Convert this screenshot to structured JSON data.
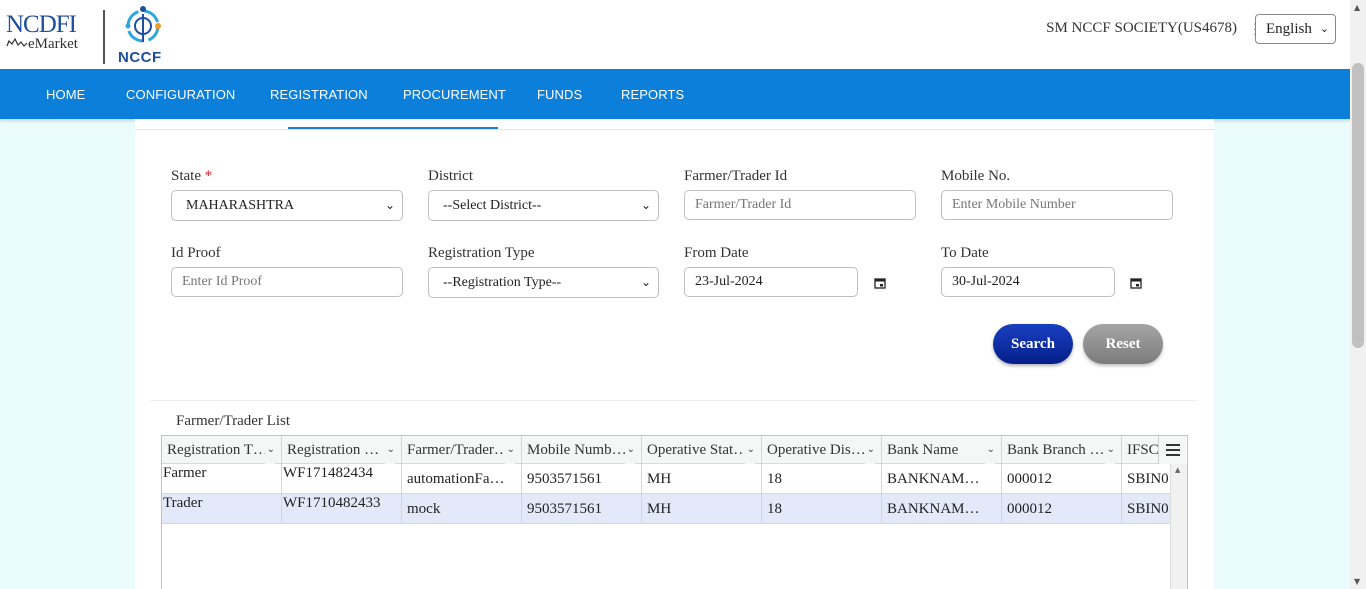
{
  "header": {
    "logo1_main": "NCDFI",
    "logo1_sub": "eMarket",
    "logo2_text": "NCCF",
    "society": "SM NCCF SOCIETY(US4678)",
    "language": "English"
  },
  "nav": [
    "HOME",
    "CONFIGURATION",
    "REGISTRATION",
    "PROCUREMENT",
    "FUNDS",
    "REPORTS"
  ],
  "form": {
    "state_label": "State",
    "required_mark": "*",
    "state_value": "MAHARASHTRA",
    "district_label": "District",
    "district_value": "--Select District--",
    "farmer_id_label": "Farmer/Trader Id",
    "farmer_id_placeholder": "Farmer/Trader Id",
    "mobile_label": "Mobile No.",
    "mobile_placeholder": "Enter Mobile Number",
    "id_proof_label": "Id Proof",
    "id_proof_placeholder": "Enter Id Proof",
    "reg_type_label": "Registration Type",
    "reg_type_value": "--Registration Type--",
    "from_date_label": "From Date",
    "from_date_value": "23-Jul-2024",
    "to_date_label": "To Date",
    "to_date_value": "30-Jul-2024",
    "search_label": "Search",
    "reset_label": "Reset"
  },
  "list": {
    "title": "Farmer/Trader List",
    "columns": [
      "Registration T…",
      "Registration …",
      "Farmer/Trader…",
      "Mobile Numb…",
      "Operative Stat…",
      "Operative Dis…",
      "Bank Name",
      "Bank Branch …",
      "IFSC"
    ],
    "rows": [
      [
        "Farmer",
        "WF171482434",
        "automationFa…",
        "9503571561",
        "MH",
        "18",
        "BANKNAM…",
        "000012",
        "SBIN0"
      ],
      [
        "Trader",
        "WF1710482433",
        "mock",
        "9503571561",
        "MH",
        "18",
        "BANKNAM…",
        "000012",
        "SBIN0"
      ]
    ]
  }
}
